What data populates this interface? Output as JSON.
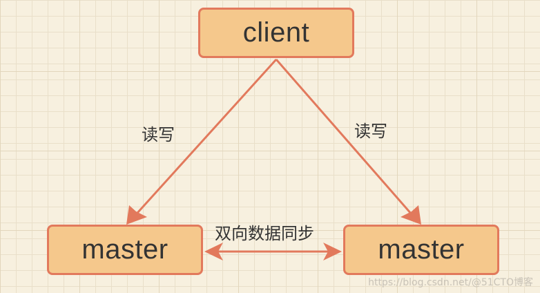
{
  "nodes": {
    "client": "client",
    "master_left": "master",
    "master_right": "master"
  },
  "edges": {
    "client_to_left": "读写",
    "client_to_right": "读写",
    "bidirectional": "双向数据同步"
  },
  "watermark": "https://blog.csdn.net/@51CTO博客",
  "colors": {
    "background": "#f7f0df",
    "node_fill": "#f5c88c",
    "node_border": "#e2795c",
    "arrow": "#e2795c",
    "text": "#333333"
  }
}
